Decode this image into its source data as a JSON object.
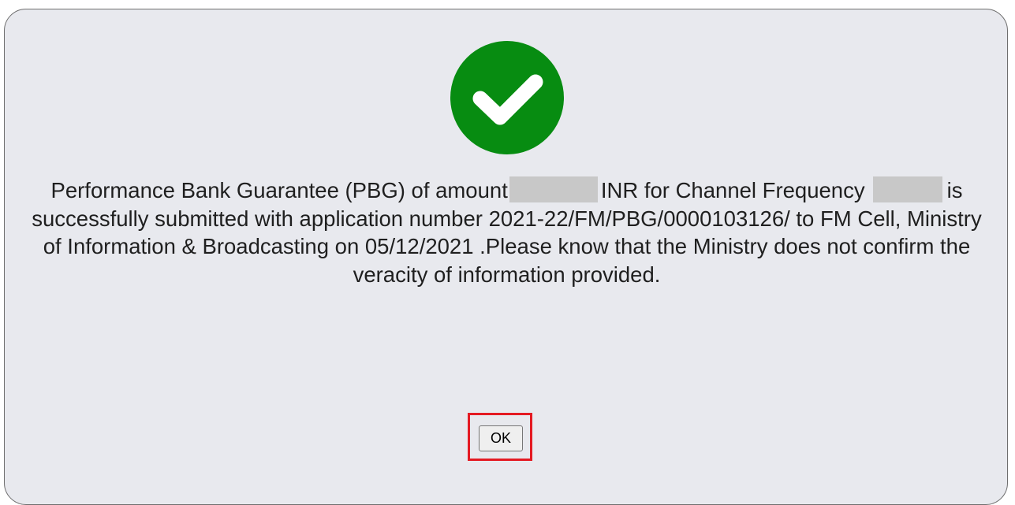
{
  "dialog": {
    "icon": "check-circle-icon",
    "icon_color": "#078c11",
    "message": {
      "part1": "Performance Bank Guarantee (PBG) of amount",
      "part2": "INR for Channel Frequency",
      "part3": "is successfully submitted with application number 2021-22/FM/PBG/0000103126/ to FM Cell, Ministry of Information & Broadcasting on 05/12/2021 .Please know that the Ministry does not confirm the veracity of information provided."
    },
    "ok_label": "OK",
    "highlight_color": "#e41a22"
  }
}
